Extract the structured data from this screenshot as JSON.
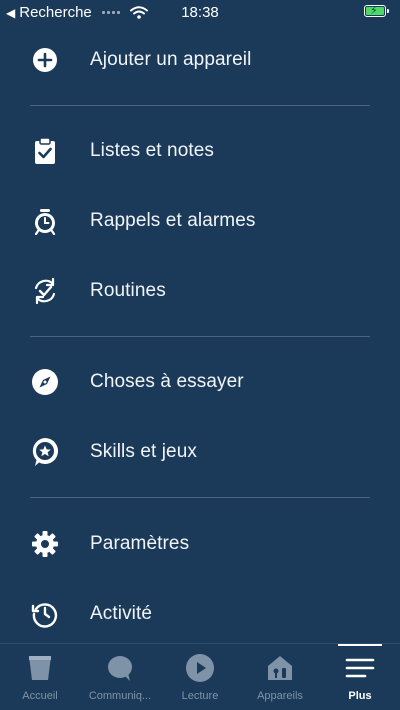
{
  "status_bar": {
    "back_label": "Recherche",
    "time": "18:38"
  },
  "menu": {
    "items": [
      {
        "label": "Ajouter un appareil",
        "icon": "plus-circle-icon"
      },
      {
        "label": "Listes et notes",
        "icon": "clipboard-check-icon"
      },
      {
        "label": "Rappels et alarmes",
        "icon": "alarm-clock-icon"
      },
      {
        "label": "Routines",
        "icon": "routines-refresh-check-icon"
      },
      {
        "label": "Choses à essayer",
        "icon": "compass-icon"
      },
      {
        "label": "Skills et jeux",
        "icon": "skills-star-bubble-icon"
      },
      {
        "label": "Paramètres",
        "icon": "gear-icon"
      },
      {
        "label": "Activité",
        "icon": "history-clock-icon"
      }
    ]
  },
  "tabbar": {
    "tabs": [
      {
        "label": "Accueil",
        "icon": "home-echo-icon"
      },
      {
        "label": "Communiq...",
        "icon": "chat-bubble-icon"
      },
      {
        "label": "Lecture",
        "icon": "play-icon"
      },
      {
        "label": "Appareils",
        "icon": "devices-house-icon"
      },
      {
        "label": "Plus",
        "icon": "menu-lines-icon"
      }
    ],
    "active": "Plus"
  },
  "colors": {
    "background": "#1b3a59",
    "inactive_tab": "#7f93a8",
    "battery": "#4cd964"
  }
}
